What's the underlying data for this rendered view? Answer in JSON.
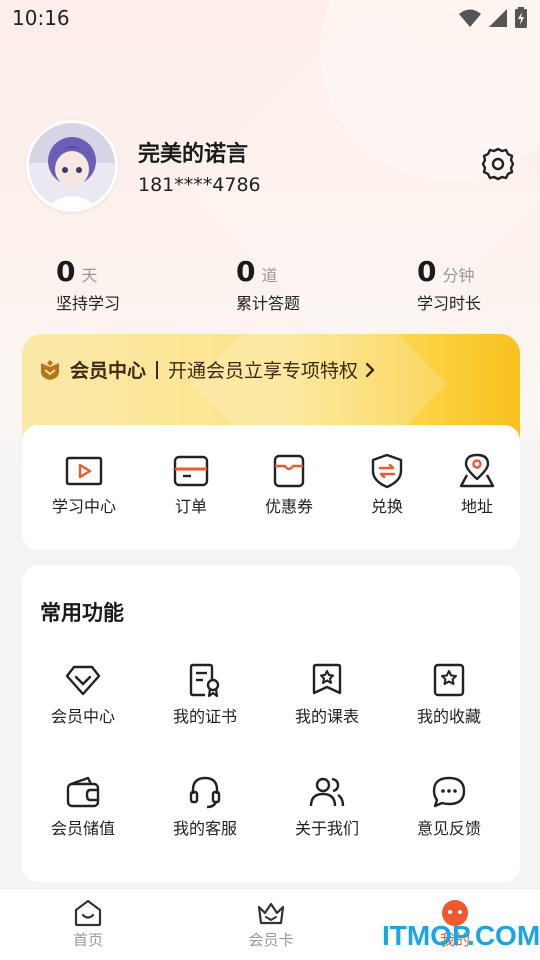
{
  "status_bar": {
    "time": "10:16"
  },
  "profile": {
    "username": "完美的诺言",
    "phone": "181****4786"
  },
  "stats": [
    {
      "value": "0",
      "unit": "天",
      "label": "坚持学习"
    },
    {
      "value": "0",
      "unit": "道",
      "label": "累计答题"
    },
    {
      "value": "0",
      "unit": "分钟",
      "label": "学习时长"
    }
  ],
  "vip_banner": {
    "title": "会员中心",
    "description": "开通会员立享专项特权"
  },
  "quick_actions": [
    {
      "label": "学习中心",
      "icon": "play-video-icon"
    },
    {
      "label": "订单",
      "icon": "order-box-icon"
    },
    {
      "label": "优惠券",
      "icon": "coupon-icon"
    },
    {
      "label": "兑换",
      "icon": "exchange-shield-icon"
    },
    {
      "label": "地址",
      "icon": "location-pin-icon"
    }
  ],
  "common_functions": {
    "title": "常用功能",
    "items": [
      {
        "label": "会员中心",
        "icon": "diamond-icon"
      },
      {
        "label": "我的证书",
        "icon": "certificate-icon"
      },
      {
        "label": "我的课表",
        "icon": "star-badge-icon"
      },
      {
        "label": "我的收藏",
        "icon": "star-bookmark-icon"
      },
      {
        "label": "会员储值",
        "icon": "wallet-icon"
      },
      {
        "label": "我的客服",
        "icon": "headset-icon"
      },
      {
        "label": "关于我们",
        "icon": "users-icon"
      },
      {
        "label": "意见反馈",
        "icon": "chat-bubble-icon"
      }
    ]
  },
  "bottom_nav": [
    {
      "label": "首页",
      "icon": "home-icon",
      "active": false
    },
    {
      "label": "会员卡",
      "icon": "crown-icon",
      "active": false
    },
    {
      "label": "我的",
      "icon": "mine-face-icon",
      "active": true
    }
  ],
  "watermark": "ITMOP.COM",
  "colors": {
    "accent": "#f2572d",
    "vip_gold": "#fbcf3c",
    "vip_text": "#3c2a12"
  }
}
